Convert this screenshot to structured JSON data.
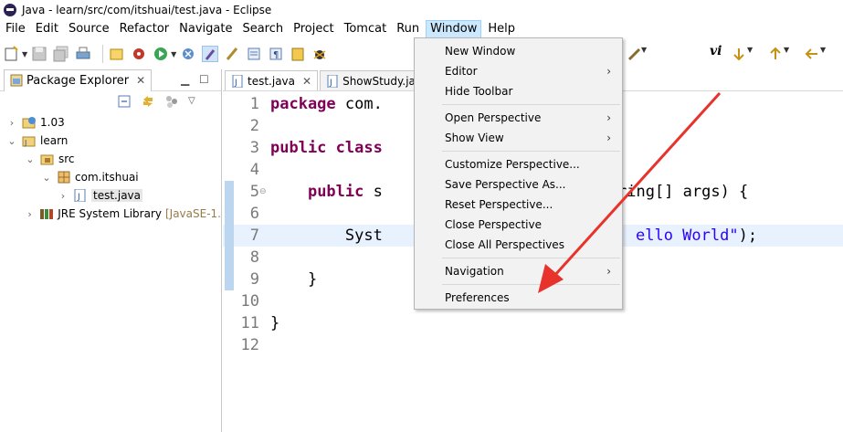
{
  "window": {
    "title": "Java - learn/src/com/itshuai/test.java - Eclipse"
  },
  "menubar": [
    "File",
    "Edit",
    "Source",
    "Refactor",
    "Navigate",
    "Search",
    "Project",
    "Tomcat",
    "Run",
    "Window",
    "Help"
  ],
  "package_explorer": {
    "tab_label": "Package Explorer",
    "tree": [
      {
        "label": "1.03",
        "extra": ""
      },
      {
        "label": "learn",
        "extra": ""
      },
      {
        "label": "src",
        "extra": ""
      },
      {
        "label": "com.itshuai",
        "extra": ""
      },
      {
        "label": "test.java",
        "extra": ""
      },
      {
        "label": "JRE System Library",
        "extra": "[JavaSE-1."
      }
    ]
  },
  "editor": {
    "tabs": [
      {
        "label": "test.java"
      },
      {
        "label": "ShowStudy.java"
      }
    ],
    "lines": [
      {
        "num": "1",
        "text": "package com."
      },
      {
        "num": "2",
        "text": ""
      },
      {
        "num": "3",
        "text": "public class"
      },
      {
        "num": "4",
        "text": ""
      },
      {
        "num": "5",
        "text": "    public s"
      },
      {
        "num": "6",
        "text": ""
      },
      {
        "num": "7",
        "text": "        Syst"
      },
      {
        "num": "8",
        "text": ""
      },
      {
        "num": "9",
        "text": "    }"
      },
      {
        "num": "10",
        "text": ""
      },
      {
        "num": "11",
        "text": "}"
      },
      {
        "num": "12",
        "text": ""
      }
    ],
    "visible_right": {
      "line5": "ring[] args) {",
      "line7": "ello World\");"
    }
  },
  "window_menu": {
    "items": [
      {
        "label": "New Window",
        "submenu": false
      },
      {
        "label": "Editor",
        "submenu": true
      },
      {
        "label": "Hide Toolbar",
        "submenu": false
      },
      {
        "label": "Open Perspective",
        "submenu": true
      },
      {
        "label": "Show View",
        "submenu": true
      },
      {
        "label": "Customize Perspective...",
        "submenu": false
      },
      {
        "label": "Save Perspective As...",
        "submenu": false
      },
      {
        "label": "Reset Perspective...",
        "submenu": false
      },
      {
        "label": "Close Perspective",
        "submenu": false
      },
      {
        "label": "Close All Perspectives",
        "submenu": false
      },
      {
        "label": "Navigation",
        "submenu": true
      },
      {
        "label": "Preferences",
        "submenu": false
      }
    ]
  },
  "colors": {
    "keyword": "#7f0055",
    "string": "#2a00ff",
    "menu_highlight": "#cce8ff",
    "annotation_arrow": "#e8322c"
  }
}
